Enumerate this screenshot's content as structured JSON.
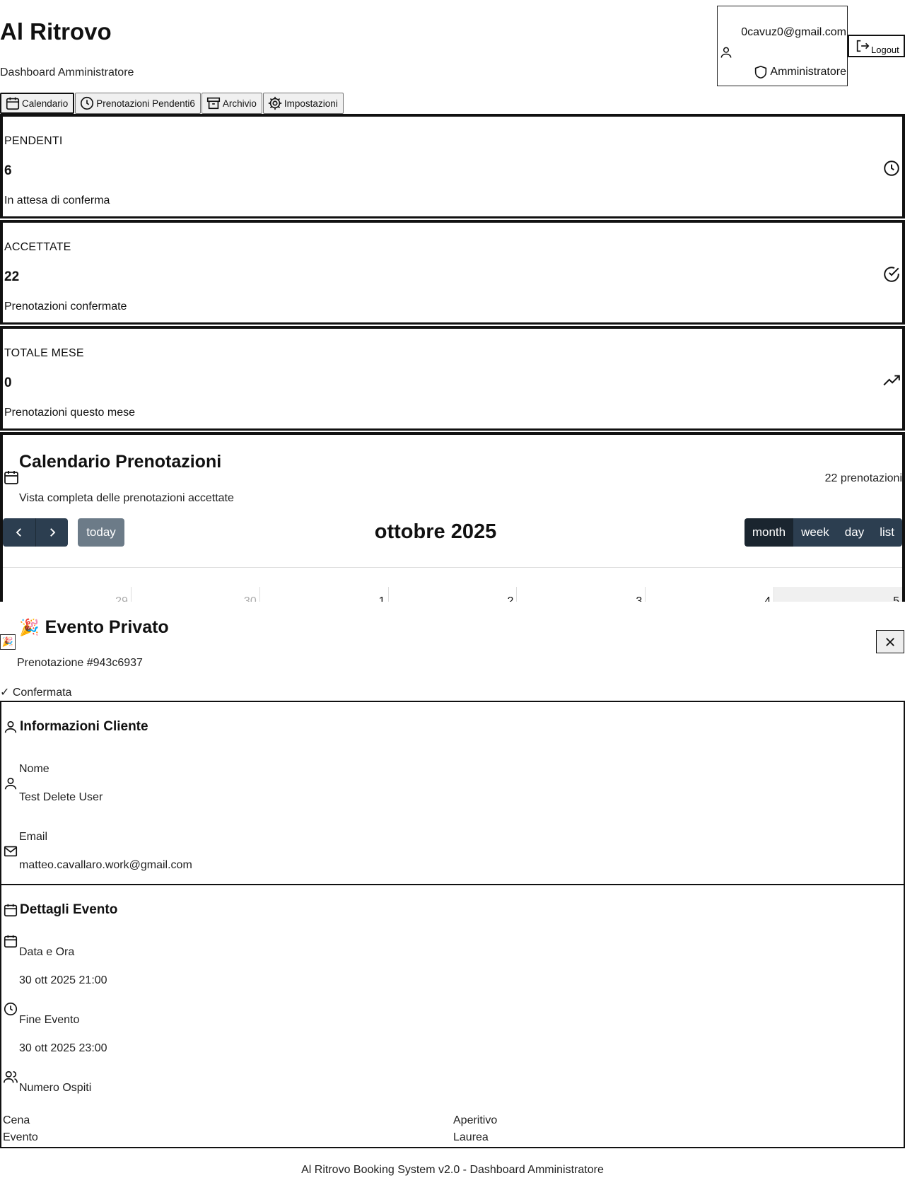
{
  "header": {
    "title": "Al Ritrovo",
    "subtitle": "Dashboard Amministratore",
    "user_email": "0cavuz0@gmail.com",
    "user_role": "Amministratore",
    "logout_label": "Logout"
  },
  "tabs": [
    {
      "label": "Calendario",
      "icon": "calendar-icon"
    },
    {
      "label": "Prenotazioni Pendenti6",
      "icon": "clock-icon"
    },
    {
      "label": "Archivio",
      "icon": "archive-icon"
    },
    {
      "label": "Impostazioni",
      "icon": "gear-icon"
    }
  ],
  "stats": [
    {
      "label": "PENDENTI",
      "value": "6",
      "description": "In attesa di conferma",
      "icon": "clock-icon"
    },
    {
      "label": "ACCETTATE",
      "value": "22",
      "description": "Prenotazioni confermate",
      "icon": "check-circle-icon"
    },
    {
      "label": "TOTALE MESE",
      "value": "0",
      "description": "Prenotazioni questo mese",
      "icon": "trending-up-icon"
    }
  ],
  "calendar": {
    "title": "Calendario Prenotazioni",
    "subtitle": "Vista completa delle prenotazioni accettate",
    "count": "22 prenotazioni",
    "month_title": "ottobre 2025",
    "today_label": "today",
    "views": [
      "month",
      "week",
      "day",
      "list"
    ],
    "active_view": "month",
    "week_days": [
      "29",
      "30",
      "1",
      "2",
      "3",
      "4",
      "5"
    ]
  },
  "modal": {
    "emoji": "🎉",
    "title": "Evento Privato",
    "booking_ref": "Prenotazione #943c6937",
    "status": "✓ Confermata",
    "client_section": {
      "title": "Informazioni Cliente",
      "name_label": "Nome",
      "name_value": "Test Delete User",
      "email_label": "Email",
      "email_value": "matteo.cavallaro.work@gmail.com"
    },
    "event_section": {
      "title": "Dettagli Evento",
      "date_label": "Data e Ora",
      "date_value": "30 ott 2025 21:00",
      "end_label": "Fine Evento",
      "end_value": "30 ott 2025 23:00",
      "guests_label": "Numero Ospiti"
    },
    "tags": [
      "Cena",
      "Aperitivo",
      "Evento",
      "Laurea"
    ]
  },
  "footer": "Al Ritrovo Booking System v2.0 - Dashboard Amministratore"
}
